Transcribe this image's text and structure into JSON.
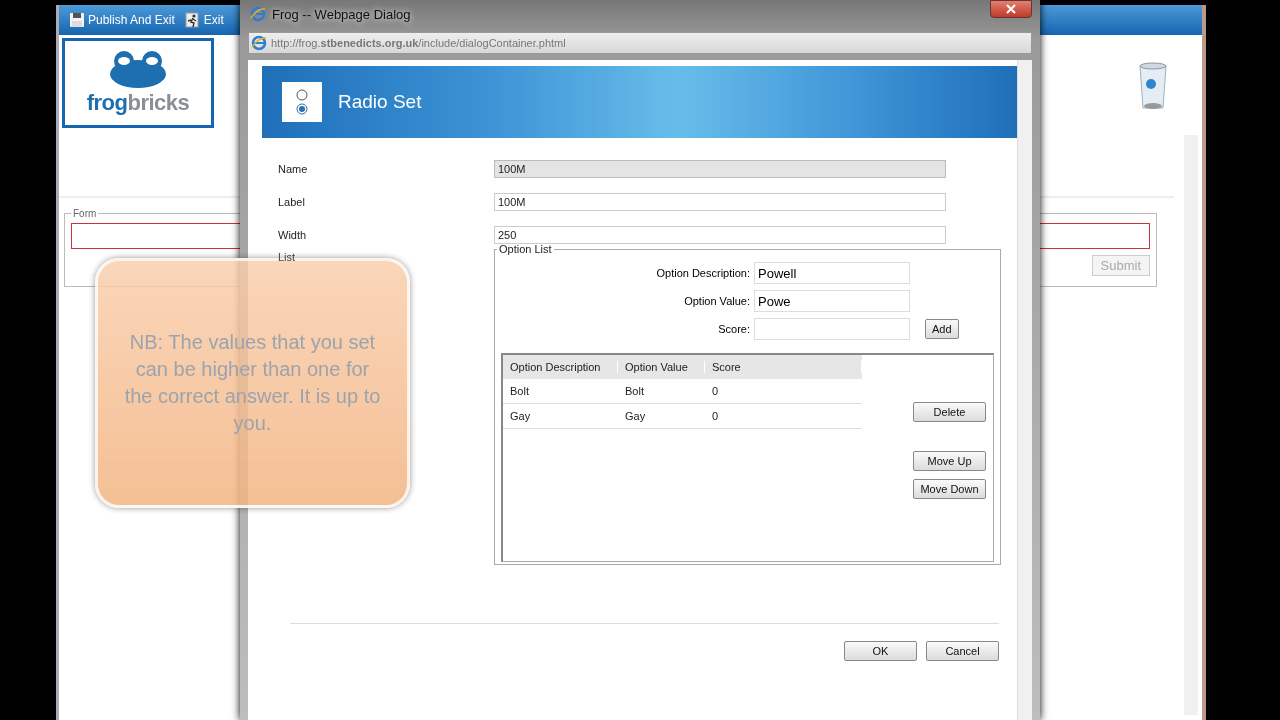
{
  "background_app": {
    "toolbar": [
      "Publish And Exit",
      "Exit"
    ],
    "logo": [
      "frog",
      "bricks"
    ],
    "form": {
      "legend": "Form",
      "submit": "Submit",
      "submit_disabled": true
    }
  },
  "dialog": {
    "title": "Frog -- Webpage Dialog",
    "url": "http://frog.**stbenedicts.org.uk**/include/dialogContainer.phtml",
    "header": "Radio Set",
    "fields": [
      {
        "label": "Name",
        "value": "100M",
        "disabled": true
      },
      {
        "label": "Label",
        "value": "100M",
        "disabled": false
      },
      {
        "label": "Width",
        "value": "250",
        "disabled": false
      }
    ],
    "list_label": "List",
    "option_list": {
      "legend": "Option List",
      "inputs": [
        {
          "label": "Option Description:",
          "value": "Powell"
        },
        {
          "label": "Option Value:",
          "value": "Powe"
        },
        {
          "label": "Score:"
        }
      ],
      "add": "Add",
      "columns": [
        "Option Description",
        "Option Value",
        "Score"
      ],
      "rows": [
        [
          "Bolt",
          "Bolt",
          "0"
        ],
        [
          "Gay",
          "Gay",
          "0"
        ]
      ],
      "side_buttons": [
        "Delete",
        "Move Up",
        "Move Down"
      ]
    },
    "buttons": [
      "OK",
      "Cancel"
    ]
  },
  "note": "NB: The values that you set can be higher than one for the correct answer. It is up to you."
}
